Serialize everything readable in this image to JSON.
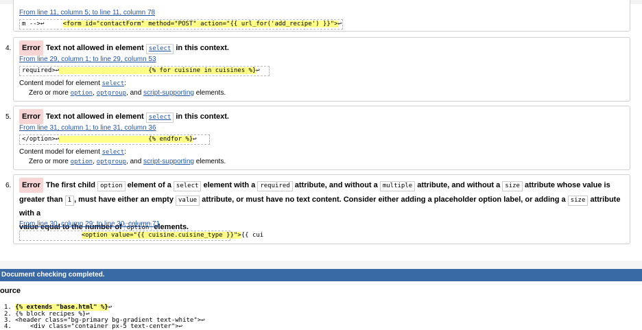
{
  "msg3": {
    "location": "From line 11, column 5; to line 11, column 78",
    "extract_prefix": "m -->↩     ",
    "extract_highlight": "<form id=\"contactForm\" method=\"POST\" action=\"{{ url_for('add_recipe') }}\">",
    "extract_suffix": "↩"
  },
  "msg4": {
    "number": "4.",
    "badge": "Error",
    "title_pre": "Text not allowed in element ",
    "title_code": "select",
    "title_post": " in this context.",
    "location": "From line 29, column 1; to line 29, column 53",
    "extract_prefix": "required>↩",
    "extract_highlight": "                        {% for cuisine in cuisines %}",
    "extract_suffix": "↩",
    "content_model_label": "Content model for element ",
    "content_model_code": "select",
    "content_model_colon": ":",
    "cm_pre": "Zero or more ",
    "cm_code1": "option",
    "cm_sep1": ", ",
    "cm_code2": "optgroup",
    "cm_sep2": ", and ",
    "cm_link": "script-supporting",
    "cm_post": " elements."
  },
  "msg5": {
    "number": "5.",
    "badge": "Error",
    "title_pre": "Text not allowed in element ",
    "title_code": "select",
    "title_post": " in this context.",
    "location": "From line 31, column 1; to line 31, column 36",
    "extract_prefix": "</option>↩",
    "extract_highlight": "                        {% endfor %}",
    "extract_suffix": "↩",
    "content_model_label": "Content model for element ",
    "content_model_code": "select",
    "content_model_colon": ":",
    "cm_pre": "Zero or more ",
    "cm_code1": "option",
    "cm_sep1": ", ",
    "cm_code2": "optgroup",
    "cm_sep2": ", and ",
    "cm_link": "script-supporting",
    "cm_post": " elements."
  },
  "msg6": {
    "number": "6.",
    "badge": "Error",
    "t1": "The first child ",
    "c1": "option",
    "t2": " element of a ",
    "c2": "select",
    "t3": " element with a ",
    "c3": "required",
    "t4": " attribute, and without a ",
    "c4": "multiple",
    "t5": " attribute, and without a ",
    "c5": "size",
    "t6": " attribute whose value is",
    "t7": "greater than ",
    "c6": "1",
    "t8": ", must have either an empty ",
    "c7": "value",
    "t9": " attribute, or must have no text content. Consider either adding a placeholder option label, or adding a ",
    "c8": "size",
    "t10": " attribute with a",
    "t11": "value equal to the number of ",
    "c9": "option",
    "t12": " elements.",
    "location": "From line 30, column 29; to line 30, column 71",
    "extract_prefix": "                ",
    "extract_highlight": "<option value=\"{{ cuisine.cuisine_type }}\">",
    "extract_suffix": "{{ cui"
  },
  "done_bar": "Document checking completed.",
  "source_heading": "ource",
  "source_lines": [
    {
      "n": "1.",
      "text_hl": "{% extends \"base.html\" %}",
      "text": "↩"
    },
    {
      "n": "2.",
      "text_hl": "",
      "text": "{% block recipes %}↩"
    },
    {
      "n": "3.",
      "text_hl": "",
      "text": "<header class=\"bg-primary bg-gradient text-white\">↩"
    },
    {
      "n": "4.",
      "text_hl": "",
      "text": "    <div class=\"container px-5 text-center\">↩"
    }
  ],
  "colors": {
    "error_badge": "#f7d5d5",
    "highlight": "#ffff88",
    "done_bar": "#3a6aa5",
    "link": "#2255aa"
  }
}
